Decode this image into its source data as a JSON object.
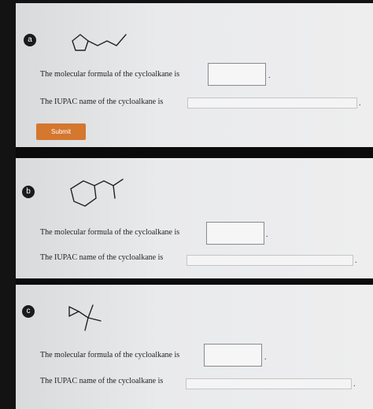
{
  "questions": [
    {
      "badge": "a",
      "formula_prompt": "The molecular formula of the cycloalkane is",
      "iupac_prompt": "The IUPAC name of the cycloalkane is",
      "formula_value": "",
      "iupac_value": "",
      "period": "."
    },
    {
      "badge": "b",
      "formula_prompt": "The molecular formula of the cycloalkane is",
      "iupac_prompt": "The IUPAC name of the cycloalkane is",
      "formula_value": "",
      "iupac_value": "",
      "period": "."
    },
    {
      "badge": "c",
      "formula_prompt": "The molecular formula of the cycloalkane is",
      "iupac_prompt": "The IUPAC name of the cycloalkane is",
      "formula_value": "",
      "iupac_value": "",
      "period": "."
    }
  ],
  "submit_label": "Submit",
  "colors": {
    "submit": "#d4772f",
    "badge": "#1b1b1b",
    "panel": "#e9eaec",
    "band": "#0b0b0b"
  }
}
